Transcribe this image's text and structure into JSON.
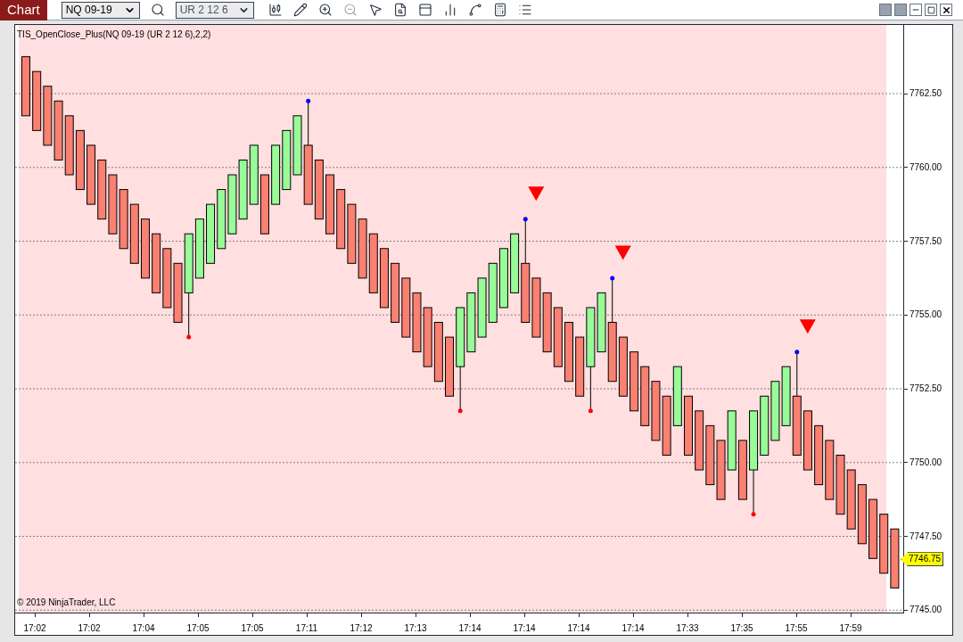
{
  "app_button": "Chart",
  "instrument": {
    "value": "NQ 09-19"
  },
  "bar_type": {
    "value": "UR 2 12 6"
  },
  "indicator_label": "TIS_OpenClose_Plus(NQ 09-19 (UR 2 12 6),2,2)",
  "copyright": "© 2019 NinjaTrader, LLC",
  "price_axis": [
    "7762.50",
    "7760.00",
    "7757.50",
    "7755.00",
    "7752.50",
    "7750.00",
    "7747.50",
    "7745.00"
  ],
  "time_axis": [
    "17:02",
    "17:02",
    "17:04",
    "17:05",
    "17:05",
    "17:11",
    "17:12",
    "17:13",
    "17:14",
    "17:14",
    "17:14",
    "17:14",
    "17:33",
    "17:35",
    "17:55",
    "17:59"
  ],
  "current_price": "7746.75"
}
